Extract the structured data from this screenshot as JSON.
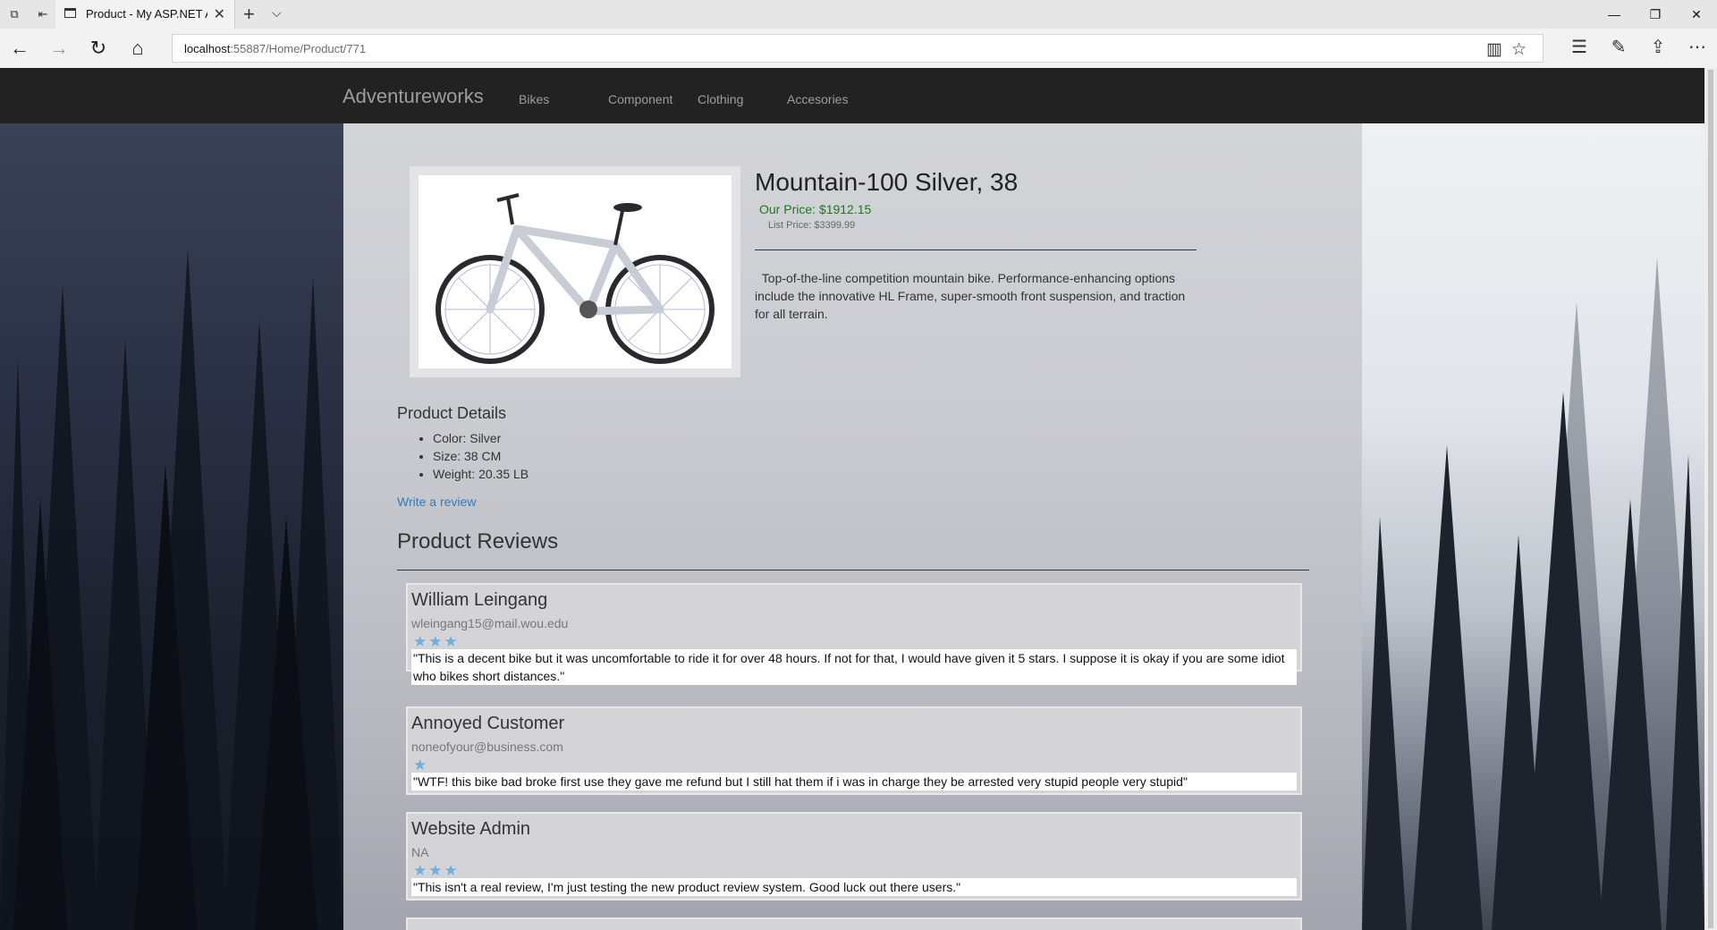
{
  "browser": {
    "tab_title": "Product - My ASP.NET A",
    "url_host": "localhost",
    "url_rest": ":55887/Home/Product/771"
  },
  "site": {
    "brand": "Adventureworks",
    "nav": [
      "Bikes",
      "Component",
      "Clothing",
      "Accesories"
    ]
  },
  "product": {
    "title": "Mountain-100 Silver, 38",
    "our_price": "Our Price: $1912.15",
    "list_price": "List Price: $3399.99",
    "description": "Top-of-the-line competition mountain bike. Performance-enhancing options include the innovative HL Frame, super-smooth front suspension, and traction for all terrain.",
    "details_heading": "Product Details",
    "details": [
      "Color: Silver",
      "Size: 38 CM",
      "Weight: 20.35 LB"
    ],
    "write_review": "Write a review"
  },
  "reviews": {
    "heading": "Product Reviews",
    "items": [
      {
        "name": "William Leingang",
        "email": "wleingang15@mail.wou.edu",
        "rating": 3,
        "stars": "★★★",
        "text": "\"This is a decent bike but it was uncomfortable to ride it for over 48 hours. If not for that, I would have given it 5 stars. I suppose it is okay if you are some idiot who bikes short distances.\""
      },
      {
        "name": "Annoyed Customer",
        "email": "noneofyour@business.com",
        "rating": 1,
        "stars": "★",
        "text": "\"WTF! this bike bad broke first use they gave me refund but I still hat them if i was in charge they be arrested very stupid people very stupid\""
      },
      {
        "name": "Website Admin",
        "email": "NA",
        "rating": 3,
        "stars": "★★★",
        "text": "\"This isn't a real review, I'm just testing the new product review system. Good luck out there users.\""
      }
    ]
  },
  "colors": {
    "navbar": "#222222",
    "link": "#337ab7",
    "price_green": "#1a7a1a",
    "star": "#6ab0e0"
  }
}
